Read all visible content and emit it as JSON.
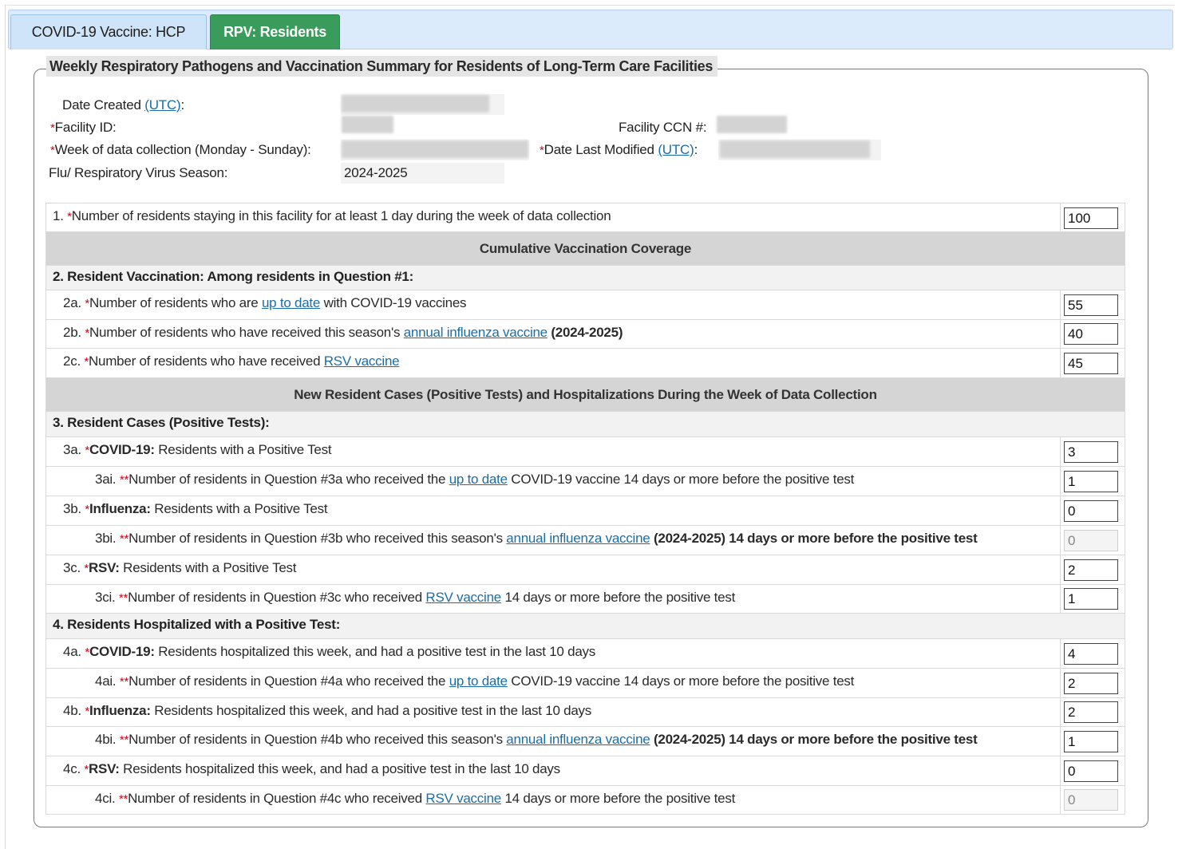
{
  "tabs": [
    {
      "label": "COVID-19 Vaccine: HCP"
    },
    {
      "label": "RPV: Residents"
    }
  ],
  "form": {
    "legend": "Weekly Respiratory Pathogens and Vaccination Summary for Residents of Long-Term Care Facilities",
    "date_created_label": "Date Created",
    "utc_link": "(UTC)",
    "colon": ":",
    "facility_id_label": "Facility ID:",
    "facility_ccn_label": "Facility CCN #:",
    "week_label": "Week of data collection (Monday - Sunday):",
    "date_modified_label": "Date Last Modified",
    "season_label": "Flu/ Respiratory Virus Season:",
    "season_value": "2024-2025",
    "required_mark": "*",
    "double_required_mark": "**"
  },
  "questions": {
    "q1": {
      "num": "1.",
      "text": "Number of residents staying in this facility for at least 1 day during the week of data collection",
      "value": "100"
    },
    "section1": "Cumulative Vaccination Coverage",
    "q2": {
      "text": "2.  Resident Vaccination: Among residents in Question #1:"
    },
    "q2a": {
      "num": "2a.",
      "pre": "Number of residents who are ",
      "link": "up to date",
      "post": " with COVID-19 vaccines",
      "value": "55"
    },
    "q2b": {
      "num": "2b.",
      "pre": "Number of residents who have received this season's ",
      "link": "annual influenza vaccine",
      "post": " (2024-2025)",
      "value": "40"
    },
    "q2c": {
      "num": "2c.",
      "pre": "Number of residents who have received ",
      "link": "RSV vaccine",
      "value": "45"
    },
    "section2": "New Resident Cases (Positive Tests) and Hospitalizations During the Week of Data Collection",
    "q3": {
      "text": "3.  Resident Cases (Positive Tests):"
    },
    "q3a": {
      "num": "3a.",
      "bold": "COVID-19:",
      "post": " Residents with a Positive Test",
      "value": "3"
    },
    "q3ai": {
      "num": "3ai.",
      "pre": "Number of residents in Question #3a who received the ",
      "link": "up to date",
      "post": " COVID-19 vaccine 14 days or more before the positive test",
      "value": "1"
    },
    "q3b": {
      "num": "3b.",
      "bold": "Influenza:",
      "post": " Residents with a Positive Test",
      "value": "0"
    },
    "q3bi": {
      "num": "3bi.",
      "pre": "Number of residents in Question #3b who received this season's ",
      "link": "annual influenza vaccine",
      "post": " (2024-2025) 14 days or more before the positive test",
      "value": "0"
    },
    "q3c": {
      "num": "3c.",
      "bold": "RSV:",
      "post": " Residents with a Positive Test",
      "value": "2"
    },
    "q3ci": {
      "num": "3ci.",
      "pre": "Number of residents in Question #3c who received ",
      "link": "RSV vaccine",
      "post": " 14 days or more before the positive test",
      "value": "1"
    },
    "q4": {
      "text": "4.  Residents Hospitalized with a Positive Test:"
    },
    "q4a": {
      "num": "4a.",
      "bold": "COVID-19:",
      "post": " Residents hospitalized this week, and had a positive test in the last 10 days",
      "value": "4"
    },
    "q4ai": {
      "num": "4ai.",
      "pre": "Number of residents in Question #4a who received the ",
      "link": "up to date",
      "post": " COVID-19 vaccine 14 days or more before the positive test",
      "value": "2"
    },
    "q4b": {
      "num": "4b.",
      "bold": "Influenza:",
      "post": " Residents hospitalized this week, and had a positive test in the last 10 days",
      "value": "2"
    },
    "q4bi": {
      "num": "4bi.",
      "pre": "Number of residents in Question #4b who received this season's ",
      "link": "annual influenza vaccine",
      "post": " (2024-2025) 14 days or more before the positive test",
      "value": "1"
    },
    "q4c": {
      "num": "4c.",
      "bold": "RSV:",
      "post": " Residents hospitalized this week, and had a positive test in the last 10 days",
      "value": "0"
    },
    "q4ci": {
      "num": "4ci.",
      "pre": "Number of residents in Question #4c who received ",
      "link": "RSV vaccine",
      "post": " 14 days or more before the positive test",
      "value": "0"
    }
  },
  "colors": {
    "active_tab": "#3a9c5a",
    "tab_bar": "#dcebfb",
    "required": "#d0021b",
    "link": "#1a6ea8",
    "section_header": "#d5d5d5"
  }
}
